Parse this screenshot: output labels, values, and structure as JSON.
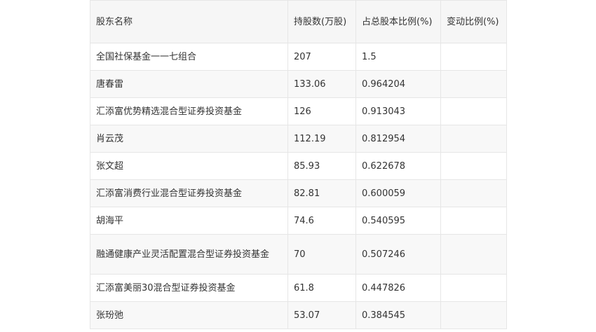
{
  "table": {
    "headers": [
      "股东名称",
      "持股数(万股)",
      "占总股本比例(%)",
      "变动比例(%)"
    ],
    "rows": [
      [
        "全国社保基金一一七组合",
        "207",
        "1.5",
        ""
      ],
      [
        "唐春雷",
        "133.06",
        "0.964204",
        ""
      ],
      [
        "汇添富优势精选混合型证券投资基金",
        "126",
        "0.913043",
        ""
      ],
      [
        "肖云茂",
        "112.19",
        "0.812954",
        ""
      ],
      [
        "张文超",
        "85.93",
        "0.622678",
        ""
      ],
      [
        "汇添富消费行业混合型证券投资基金",
        "82.81",
        "0.600059",
        ""
      ],
      [
        "胡海平",
        "74.6",
        "0.540595",
        ""
      ],
      [
        "融通健康产业灵活配置混合型证券投资基金",
        "70",
        "0.507246",
        ""
      ],
      [
        "汇添富美丽30混合型证券投资基金",
        "61.8",
        "0.447826",
        ""
      ],
      [
        "张玢弛",
        "53.07",
        "0.384545",
        ""
      ]
    ]
  }
}
